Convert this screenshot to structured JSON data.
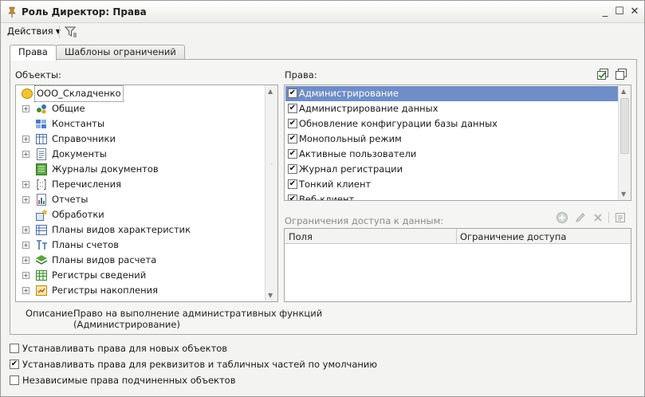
{
  "window": {
    "title": "Роль Директор: Права",
    "minimize_glyph": "_",
    "maximize_glyph": "☐",
    "close_glyph": "✕"
  },
  "toolbar": {
    "actions_label": "Действия",
    "filter_icon": "filter-funnel-icon"
  },
  "tabs": [
    {
      "label": "Права",
      "active": true
    },
    {
      "label": "Шаблоны ограничений",
      "active": false
    }
  ],
  "objects": {
    "label": "Объекты:",
    "items": [
      {
        "label": "ООО_Складченко",
        "icon": "company-icon",
        "expandable": false,
        "root": true
      },
      {
        "label": "Общие",
        "icon": "common-icon",
        "expandable": true
      },
      {
        "label": "Константы",
        "icon": "constants-icon",
        "expandable": false
      },
      {
        "label": "Справочники",
        "icon": "catalogs-icon",
        "expandable": true
      },
      {
        "label": "Документы",
        "icon": "documents-icon",
        "expandable": true
      },
      {
        "label": "Журналы документов",
        "icon": "journals-icon",
        "expandable": false
      },
      {
        "label": "Перечисления",
        "icon": "enumerations-icon",
        "expandable": true
      },
      {
        "label": "Отчеты",
        "icon": "reports-icon",
        "expandable": true
      },
      {
        "label": "Обработки",
        "icon": "dataprocessors-icon",
        "expandable": false
      },
      {
        "label": "Планы видов характеристик",
        "icon": "char-types-icon",
        "expandable": true
      },
      {
        "label": "Планы счетов",
        "icon": "accounts-icon",
        "expandable": true
      },
      {
        "label": "Планы видов расчета",
        "icon": "calc-types-icon",
        "expandable": true
      },
      {
        "label": "Регистры сведений",
        "icon": "info-registers-icon",
        "expandable": true
      },
      {
        "label": "Регистры накопления",
        "icon": "accum-registers-icon",
        "expandable": true
      }
    ]
  },
  "description": {
    "label": "Описание:",
    "line1": "Право на выполнение административных функций",
    "line2": "(Администрирование)"
  },
  "rights": {
    "label": "Права:",
    "items": [
      {
        "label": "Администрирование",
        "checked": true,
        "selected": true
      },
      {
        "label": "Администрирование данных",
        "checked": true
      },
      {
        "label": "Обновление конфигурации базы данных",
        "checked": true
      },
      {
        "label": "Монопольный режим",
        "checked": true
      },
      {
        "label": "Активные пользователи",
        "checked": true
      },
      {
        "label": "Журнал регистрации",
        "checked": true
      },
      {
        "label": "Тонкий клиент",
        "checked": true
      },
      {
        "label": "Веб-клиент",
        "checked": true
      }
    ]
  },
  "restrictions": {
    "label": "Ограничения доступа к данным:",
    "columns": [
      "Поля",
      "Ограничение доступа"
    ]
  },
  "options": [
    {
      "label": "Устанавливать права для новых объектов",
      "checked": false
    },
    {
      "label": "Устанавливать права для реквизитов и табличных частей по умолчанию",
      "checked": true
    },
    {
      "label": "Независимые права подчиненных объектов",
      "checked": false
    }
  ],
  "colors": {
    "selection": "#6f8dc7",
    "accent_green": "#4a9a3a"
  }
}
